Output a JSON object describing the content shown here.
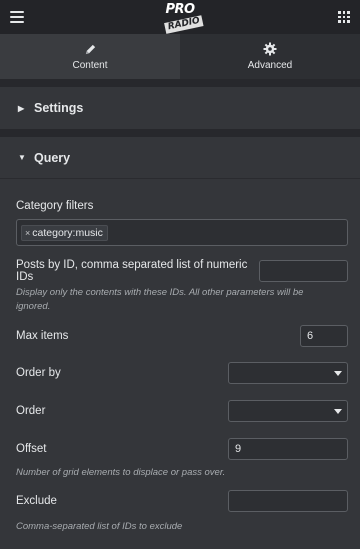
{
  "topbar": {
    "logo_top": "PRO",
    "logo_bottom": "RADIO",
    "menu_icon": "hamburger-icon",
    "apps_icon": "grid-icon"
  },
  "tabs": [
    {
      "label": "Content",
      "icon": "pencil-icon",
      "active": true
    },
    {
      "label": "Advanced",
      "icon": "gear-icon",
      "active": false
    }
  ],
  "sections": {
    "settings": {
      "title": "Settings",
      "expanded": false
    },
    "query": {
      "title": "Query",
      "expanded": true
    }
  },
  "query": {
    "category_filters": {
      "label": "Category filters",
      "chip": "category:music",
      "chip_remove": "×"
    },
    "posts_by_id": {
      "label": "Posts by ID, comma separated list of numeric IDs",
      "value": "",
      "description": "Display only the contents with these IDs. All other parameters will be ignored."
    },
    "max_items": {
      "label": "Max items",
      "value": "6"
    },
    "order_by": {
      "label": "Order by",
      "value": ""
    },
    "order": {
      "label": "Order",
      "value": ""
    },
    "offset": {
      "label": "Offset",
      "value": "9",
      "description": "Number of grid elements to displace or pass over."
    },
    "exclude": {
      "label": "Exclude",
      "value": "",
      "description": "Comma-separated list of IDs to exclude"
    }
  },
  "colors": {
    "background": "#2d2f33",
    "topbar": "#232428",
    "panel": "#34363a",
    "text": "#e6e8ea",
    "muted": "#a8acb0",
    "border": "#5b5e63"
  }
}
